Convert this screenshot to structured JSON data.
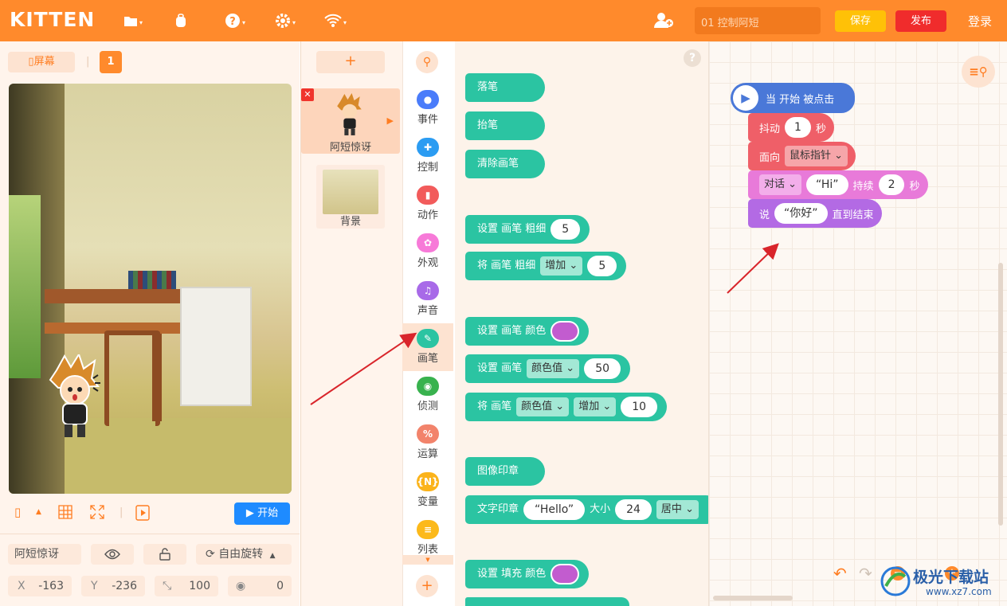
{
  "header": {
    "logo": "KITTEN",
    "project_name": "01 控制阿短",
    "save_label": "保存",
    "publish_label": "发布",
    "login_label": "登录",
    "icons": [
      "folder-icon",
      "backpack-icon",
      "help-icon",
      "settings-icon",
      "wifi-icon"
    ]
  },
  "stage_panel": {
    "screen_label": "屏幕",
    "scene_number": "1",
    "start_label": "开始",
    "sprite_name": "阿短惊讶",
    "rotation_label": "自由旋转",
    "x_label": "X",
    "x_value": "-163",
    "y_label": "Y",
    "y_value": "-236",
    "size_value": "100",
    "direction_value": "0"
  },
  "sprites": {
    "add_label": "+",
    "items": [
      {
        "name": "阿短惊讶"
      },
      {
        "name": "背景"
      }
    ]
  },
  "categories": [
    {
      "label": "事件",
      "color": "#4a7cfa",
      "glyph": "●"
    },
    {
      "label": "控制",
      "color": "#2b9cf2",
      "glyph": "✚"
    },
    {
      "label": "动作",
      "color": "#f25b5b",
      "glyph": "▮"
    },
    {
      "label": "外观",
      "color": "#f77ad8",
      "glyph": "✿"
    },
    {
      "label": "声音",
      "color": "#a86ae8",
      "glyph": "♫"
    },
    {
      "label": "画笔",
      "color": "#2bc4a2",
      "glyph": "✎"
    },
    {
      "label": "侦测",
      "color": "#38b24e",
      "glyph": "◉"
    },
    {
      "label": "运算",
      "color": "#f2836b",
      "glyph": "%"
    },
    {
      "label": "变量",
      "color": "#fbb31a",
      "glyph": "{N}"
    },
    {
      "label": "列表",
      "color": "#fcb91a",
      "glyph": "≡"
    }
  ],
  "palette_blocks": {
    "pen_down": "落笔",
    "pen_up": "抬笔",
    "clear": "清除画笔",
    "set_size": {
      "text": "设置 画笔 粗细",
      "value": "5"
    },
    "change_size": {
      "text": "将 画笔 粗细",
      "op": "增加",
      "value": "5"
    },
    "set_color": {
      "text": "设置 画笔 颜色"
    },
    "set_color_value": {
      "text": "设置 画笔",
      "param": "颜色值",
      "value": "50"
    },
    "change_color_value": {
      "text": "将 画笔",
      "param": "颜色值",
      "op": "增加",
      "value": "10"
    },
    "stamp": "图像印章",
    "text_stamp": {
      "text": "文字印章",
      "content": "“Hello”",
      "size_label": "大小",
      "size": "24",
      "align": "居中"
    },
    "set_fill": {
      "text": "设置 填充 颜色"
    }
  },
  "script": {
    "hat": "当 开始 被点击",
    "shake": {
      "label": "抖动",
      "value": "1",
      "unit": "秒"
    },
    "face": {
      "label": "面向",
      "target": "鼠标指针"
    },
    "dialog": {
      "type": "对话",
      "text": "“Hi”",
      "label": "持续",
      "value": "2",
      "unit": "秒"
    },
    "say": {
      "label": "说",
      "text": "“你好”",
      "suffix": "直到结束"
    }
  },
  "watermark": "极光下载站",
  "watermark_url": "www.xz7.com"
}
